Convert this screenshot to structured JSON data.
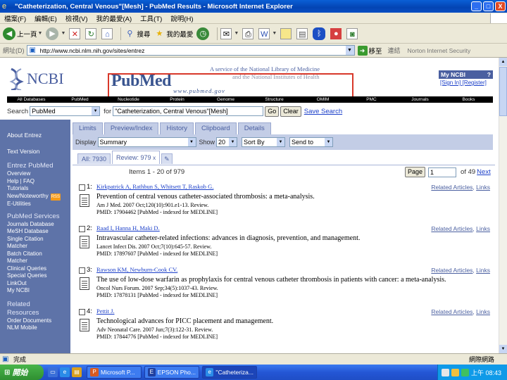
{
  "window": {
    "title": "\"Catheterization, Central Venous\"[Mesh] - PubMed Results - Microsoft Internet Explorer",
    "controls": [
      "_",
      "□",
      "X"
    ]
  },
  "menu": [
    "檔案(F)",
    "編輯(E)",
    "檢視(V)",
    "我的最愛(A)",
    "工具(T)",
    "說明(H)"
  ],
  "toolbar": {
    "back": "上一頁",
    "search": "搜尋",
    "favorites": "我的最愛"
  },
  "address": {
    "label": "網址(D)",
    "url": "http://www.ncbi.nlm.nih.gov/sites/entrez",
    "go": "移至",
    "links": "連結",
    "norton": "Norton Internet Security"
  },
  "ncbi": {
    "logo": "NCBI",
    "pubmed_logo": "PubMed",
    "pubmed_url": "www.pubmed.gov",
    "service_line1": "A service of the National Library of Medicine",
    "service_line2": "and the National Institutes of Health",
    "myncbi": {
      "title": "My NCBI",
      "help": "?",
      "signin": "[Sign In]",
      "register": "[Register]"
    },
    "nav": [
      "All Databases",
      "PubMed",
      "Nucleotide",
      "Protein",
      "Genome",
      "Structure",
      "OMIM",
      "PMC",
      "Journals",
      "Books"
    ]
  },
  "search": {
    "label": "Search",
    "db": "PubMed",
    "for_label": "for",
    "query": "\"Catheterization, Central Venous\"[Mesh]",
    "go": "Go",
    "clear": "Clear",
    "save": "Save Search"
  },
  "sidebar": {
    "about": "About Entrez",
    "text_version": "Text Version",
    "section1": "Entrez PubMed",
    "section1_items": [
      "Overview",
      "Help | FAQ",
      "Tutorials",
      "New/Noteworthy",
      "E-Utilities"
    ],
    "rss": "RSS",
    "section2": "PubMed Services",
    "section2_items": [
      "Journals Database",
      "MeSH Database",
      "Single Citation",
      "Matcher",
      "Batch Citation",
      "Matcher",
      "Clinical Queries",
      "Special Queries",
      "LinkOut",
      "My NCBI"
    ],
    "section3": "Related Resources",
    "section3_line1": "Related",
    "section3_line2": "Resources",
    "section3_items": [
      "Order Documents",
      "NLM Mobile"
    ]
  },
  "tabs": [
    "Limits",
    "Preview/Index",
    "History",
    "Clipboard",
    "Details"
  ],
  "display": {
    "display_label": "Display",
    "display_value": "Summary",
    "show_label": "Show",
    "show_value": "20",
    "sort_value": "Sort By",
    "send_value": "Send to"
  },
  "subtabs": {
    "all": "All: 7930",
    "review": "Review: 979",
    "close": "x"
  },
  "items_header": "Items 1 - 20 of 979",
  "pager": {
    "button": "Page",
    "value": "1",
    "of": "of 49",
    "next": "Next"
  },
  "results": [
    {
      "num": "1:",
      "authors": "Kirkpatrick A, Rathbun S, Whitsett T, Raskob G.",
      "title": "Prevention of central venous catheter-associated thrombosis: a meta-analysis.",
      "source": "Am J Med. 2007 Oct;120(10):901.e1-13. Review.",
      "pmid": "PMID: 17904462 [PubMed - indexed for MEDLINE]",
      "related": "Related Articles",
      "links": "Links"
    },
    {
      "num": "2:",
      "authors": "Raad I, Hanna H, Maki D.",
      "title": "Intravascular catheter-related infections: advances in diagnosis, prevention, and management.",
      "source": "Lancet Infect Dis. 2007 Oct;7(10):645-57. Review.",
      "pmid": "PMID: 17897607 [PubMed - indexed for MEDLINE]",
      "related": "Related Articles",
      "links": "Links"
    },
    {
      "num": "3:",
      "authors": "Rawson KM, Newburn-Cook CV.",
      "title": "The use of low-dose warfarin as prophylaxis for central venous catheter thrombosis in patients with cancer: a meta-analysis.",
      "source": "Oncol Nurs Forum. 2007 Sep;34(5):1037-43. Review.",
      "pmid": "PMID: 17878131 [PubMed - indexed for MEDLINE]",
      "related": "Related Articles",
      "links": "Links"
    },
    {
      "num": "4:",
      "authors": "Pettit J.",
      "title": "Technological advances for PICC placement and management.",
      "source": "Adv Neonatal Care. 2007 Jun;7(3):122-31. Review.",
      "pmid": "PMID: 17844776 [PubMed - indexed for MEDLINE]",
      "related": "Related Articles",
      "links": "Links"
    }
  ],
  "status": {
    "done": "完成",
    "zone": "網際網路"
  },
  "taskbar": {
    "start": "開始",
    "tasks": [
      "Microsoft P...",
      "EPSON Pho...",
      "\"Catheteriza..."
    ],
    "clock": "上午 08:43"
  },
  "colors": {
    "ncbi_blue": "#4a5fa0",
    "sidebar": "#5e73a8",
    "highlight_box": "#d8382a",
    "link": "#1a3ec9"
  }
}
